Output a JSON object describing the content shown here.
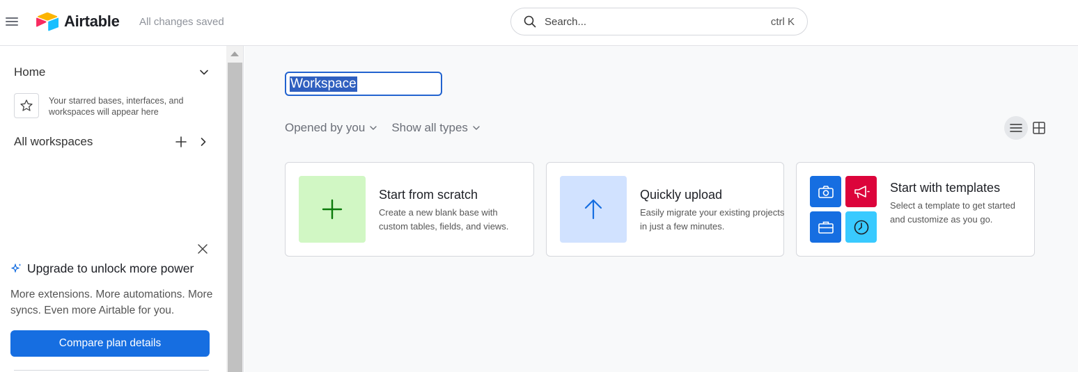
{
  "app": {
    "brand": "Airtable",
    "save_status": "All changes saved"
  },
  "search": {
    "placeholder": "Search...",
    "shortcut": "ctrl K"
  },
  "sidebar": {
    "home_label": "Home",
    "starred_empty_text": "Your starred bases, interfaces, and workspaces will appear here",
    "workspaces_label": "All workspaces"
  },
  "upgrade": {
    "title": "Upgrade to unlock more power",
    "body": "More extensions. More automations. More syncs. Even more Airtable for you.",
    "button_label": "Compare plan details"
  },
  "main": {
    "workspace_name": "Workspace",
    "filters": [
      {
        "label": "Opened by you"
      },
      {
        "label": "Show all types"
      }
    ],
    "cards": [
      {
        "title": "Start from scratch",
        "description": "Create a new blank base with custom tables, fields, and views.",
        "icon": "plus-icon",
        "color": "#d1f7c4"
      },
      {
        "title": "Quickly upload",
        "description": "Easily migrate your existing projects in just a few minutes.",
        "icon": "arrow-up-icon",
        "color": "#d1e2ff"
      },
      {
        "title": "Start with templates",
        "description": "Select a template to get started and customize as you go.",
        "icon": "templates-icon",
        "color": "#166ee1"
      }
    ]
  },
  "colors": {
    "accent": "#166ee1",
    "template_red": "#dc043b",
    "template_cyan": "#39caff",
    "main_bg": "#f8f9fa"
  }
}
